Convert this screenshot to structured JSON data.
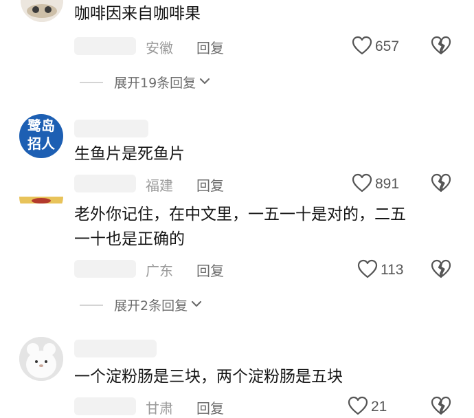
{
  "comments": [
    {
      "text": "咖啡因来自咖啡果",
      "location": "安徽",
      "reply_label": "回复",
      "likes": "657",
      "expand_label": "展开19条回复"
    },
    {
      "avatar_text": [
        "鹭岛",
        "招人"
      ],
      "text": "生鱼片是死鱼片",
      "location": "福建",
      "reply_label": "回复",
      "likes": "891"
    },
    {
      "text_line1": "老外你记住，在中文里，一五一十是对的，二五",
      "text_line2": "一十也是正确的",
      "location": "广东",
      "reply_label": "回复",
      "likes": "113",
      "expand_label": "展开2条回复"
    },
    {
      "text": "一个淀粉肠是三块，两个淀粉肠是五块",
      "location": "甘肃",
      "reply_label": "回复",
      "likes": "21"
    }
  ],
  "colors": {
    "avatar2_bg": "#1d5fb3",
    "text": "#161616",
    "meta": "#9a9a9a"
  },
  "icons": {
    "like": "heart-outline-icon",
    "dislike": "broken-heart-icon",
    "expand": "chevron-down-icon"
  }
}
